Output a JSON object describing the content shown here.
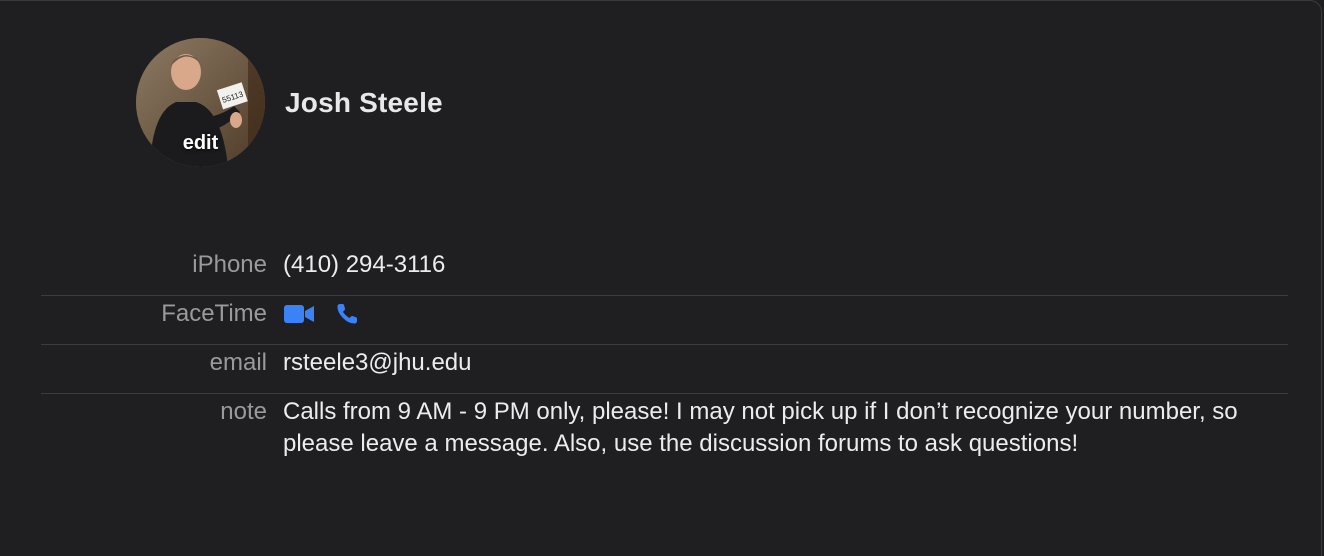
{
  "contact": {
    "name": "Josh Steele",
    "avatar_edit_label": "edit"
  },
  "fields": {
    "phone": {
      "label": "iPhone",
      "value": "(410) 294-3116"
    },
    "facetime": {
      "label": "FaceTime",
      "video_icon": "video-camera-icon",
      "audio_icon": "phone-icon"
    },
    "email": {
      "label": "email",
      "value": "rsteele3@jhu.edu"
    },
    "note": {
      "label": "note",
      "value": "Calls from 9 AM - 9 PM only, please!  I may not pick up if I don’t recognize your number, so please leave a message.  Also, use the discussion forums to ask questions!"
    }
  },
  "colors": {
    "accent": "#3b82f6",
    "background": "#1f1f22",
    "label": "#9a9a9e",
    "divider": "#3c3c3f"
  }
}
